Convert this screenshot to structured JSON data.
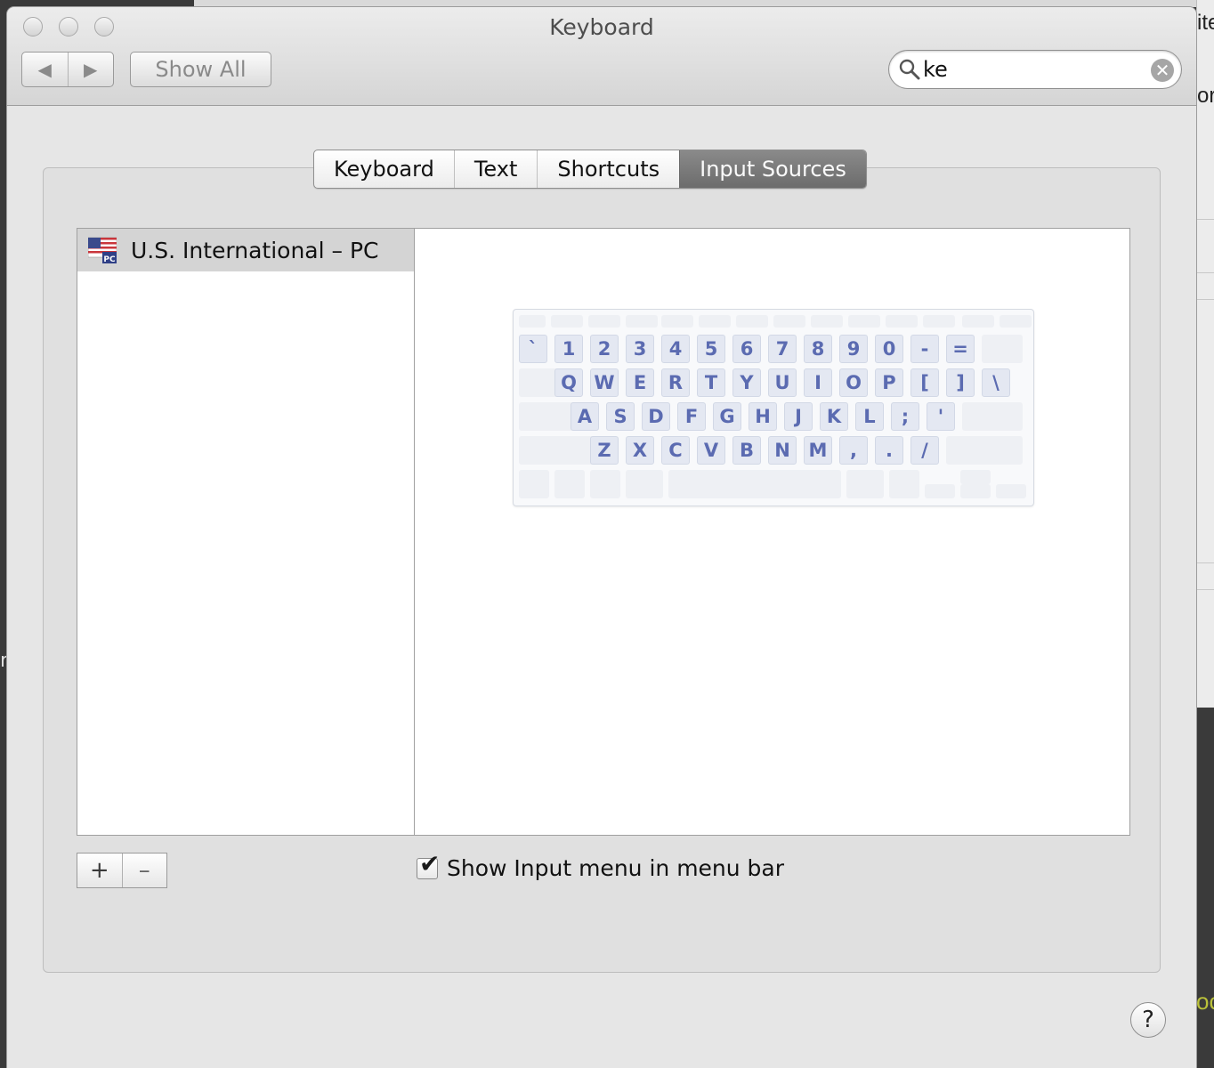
{
  "window": {
    "title": "Keyboard",
    "show_all_label": "Show All",
    "back_arrow": "◀",
    "forward_arrow": "▶"
  },
  "search": {
    "value": "ke",
    "placeholder": "",
    "clear_glyph": "✕"
  },
  "tabs": [
    {
      "label": "Keyboard",
      "active": false
    },
    {
      "label": "Text",
      "active": false
    },
    {
      "label": "Shortcuts",
      "active": false
    },
    {
      "label": "Input Sources",
      "active": true
    }
  ],
  "input_sources": [
    {
      "label": "U.S. International – PC",
      "flag": "us-flag-pc-icon",
      "flag_badge": "PC",
      "selected": true
    }
  ],
  "keyboard_preview": {
    "rows": [
      [
        "`",
        "1",
        "2",
        "3",
        "4",
        "5",
        "6",
        "7",
        "8",
        "9",
        "0",
        "-",
        "="
      ],
      [
        "Q",
        "W",
        "E",
        "R",
        "T",
        "Y",
        "U",
        "I",
        "O",
        "P",
        "[",
        "]",
        "\\"
      ],
      [
        "A",
        "S",
        "D",
        "F",
        "G",
        "H",
        "J",
        "K",
        "L",
        ";",
        "'"
      ],
      [
        "Z",
        "X",
        "C",
        "V",
        "B",
        "N",
        "M",
        ",",
        ".",
        "/"
      ]
    ]
  },
  "list_controls": {
    "add_label": "+",
    "remove_label": "–"
  },
  "show_input_menu": {
    "label": "Show Input menu in menu bar",
    "checked": true,
    "check_glyph": "✔"
  },
  "help_label": "?",
  "background_fragments": {
    "right_top": "ite",
    "right_mid": "or",
    "right_bottom": "oc",
    "left": "n"
  },
  "colors": {
    "active_tab": "#6c6c6c",
    "key_label": "#5b6bb1",
    "selected_row": "#d4d4d4"
  }
}
